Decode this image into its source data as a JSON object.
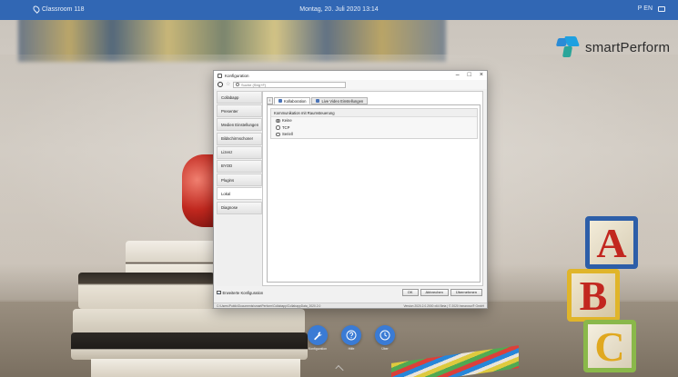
{
  "topbar": {
    "location": "Classroom 118",
    "datetime": "Montag, 20. Juli 2020  13:14",
    "language": "P EN",
    "accent": "#3167b4"
  },
  "logo": {
    "text": "smartPerform"
  },
  "config_window": {
    "title": "Konfiguration",
    "search_placeholder": "Suche (Strg+F)",
    "sidebar_items": [
      {
        "label": "Collabapp",
        "active": false
      },
      {
        "label": "Presenter",
        "active": false
      },
      {
        "label": "Medien Einstellungen",
        "active": false
      },
      {
        "label": "Bildschirmschoner",
        "active": false
      },
      {
        "label": "Lizenz",
        "active": false
      },
      {
        "label": "BYOD",
        "active": false
      },
      {
        "label": "Plugins",
        "active": false
      },
      {
        "label": "Lokal",
        "active": true
      },
      {
        "label": "Diagnose",
        "active": false
      }
    ],
    "tabs": [
      {
        "label": "Kollaboration",
        "active": true
      },
      {
        "label": "Live Video Einstellungen",
        "active": false
      }
    ],
    "group_title": "Kommunikation mit Raumsteuerung",
    "radio_options": [
      {
        "label": "Keine",
        "selected": true
      },
      {
        "label": "TCP",
        "selected": false
      },
      {
        "label": "Seriell",
        "selected": false
      }
    ],
    "extended_config_label": "Erweiterte Konfiguration",
    "buttons": {
      "ok": "OK",
      "cancel": "Abbrechen",
      "apply": "Übernehmen"
    },
    "status_path": "C:\\Users\\Public\\Documents\\smartPerform\\Collabapp\\CollabappData_2020.2.0",
    "status_version": "Version 2020.2.0.2000 x64 Beta | © 2020 Inmanovo® GmbH"
  },
  "dock": [
    {
      "label": "Konfiguration",
      "icon": "wrench-icon"
    },
    {
      "label": "Hilfe",
      "icon": "question-icon"
    },
    {
      "label": "Über",
      "icon": "clock-icon"
    }
  ]
}
